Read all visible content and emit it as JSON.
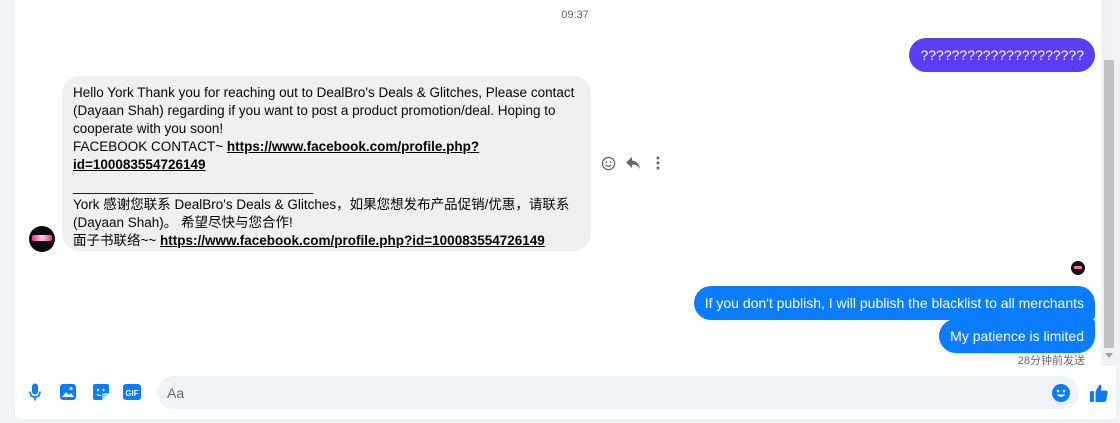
{
  "timestamp": "09:37",
  "messages_out_top": "?????????????????????",
  "incoming": {
    "lines": [
      "Hello York Thank you for reaching out to DealBro's Deals & Glitches, Please contact",
      "(Dayaan Shah) regarding if you want to post a product promotion/deal. Hoping to",
      "cooperate with you soon!"
    ],
    "fb_label": "FACEBOOK CONTACT~ ",
    "fb_link_1": "https://www.facebook.com/profile.php?",
    "fb_link_2": "id=100083554726149",
    "separator": "________________________________",
    "zh_line_1": " York  感谢您联系 DealBro's Deals & Glitches，如果您想发布产品促销/优惠，请联系",
    "zh_line_2": "(Dayaan Shah)。 希望尽快与您合作!",
    "zh_label": "面子书联络~~ ",
    "zh_link": "https://www.facebook.com/profile.php?id=100083554726149"
  },
  "outgoing": [
    "If you don't publish, I will publish the blacklist to all merchants",
    "My patience is limited"
  ],
  "sent_status": "28分钟前发送",
  "composer": {
    "placeholder": "Aa",
    "value": ""
  },
  "colors": {
    "outgoing_blue": "#0a7cff",
    "outgoing_purple": "#5b3df5",
    "icon_blue": "#0a7cff"
  },
  "icons": [
    "react-icon",
    "reply-icon",
    "more-icon",
    "microphone-icon",
    "image-icon",
    "sticker-icon",
    "gif-icon",
    "emoji-icon",
    "like-icon"
  ]
}
